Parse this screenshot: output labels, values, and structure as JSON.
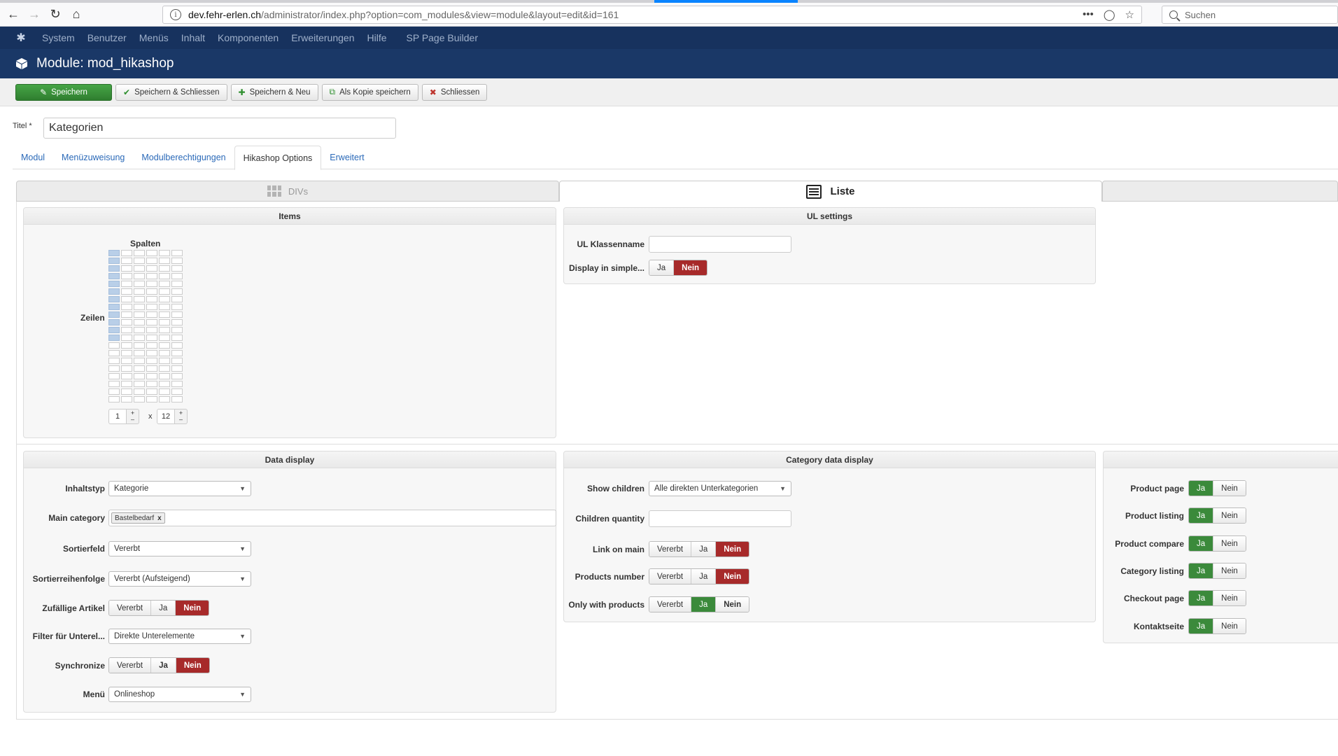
{
  "browser": {
    "url_host": "dev.fehr-erlen.ch",
    "url_path": "/administrator/index.php?option=com_modules&view=module&layout=edit&id=161",
    "search_placeholder": "Suchen",
    "url_actions_more": "•••"
  },
  "admin_menu": [
    "System",
    "Benutzer",
    "Menüs",
    "Inhalt",
    "Komponenten",
    "Erweiterungen",
    "Hilfe",
    "SP Page Builder"
  ],
  "page_title": "Module: mod_hikashop",
  "toolbar": {
    "save": "Speichern",
    "save_close": "Speichern & Schliessen",
    "save_new": "Speichern & Neu",
    "save_copy": "Als Kopie speichern",
    "close": "Schliessen"
  },
  "title_field": {
    "label": "Titel *",
    "value": "Kategorien"
  },
  "tabs": [
    "Modul",
    "Menüzuweisung",
    "Modulberechtigungen",
    "Hikashop Options",
    "Erweitert"
  ],
  "layout_tabs": {
    "divs": "DIVs",
    "list": "Liste"
  },
  "items_panel": {
    "title": "Items",
    "columns_label": "Spalten",
    "rows_label": "Zeilen",
    "columns_value": "1",
    "rows_value": "12",
    "times": "x",
    "plus": "+",
    "minus": "–"
  },
  "ul_panel": {
    "title": "UL settings",
    "class_label": "UL Klassenname",
    "simple_label": "Display in simple...",
    "simple_options": [
      "Ja",
      "Nein"
    ]
  },
  "data_display": {
    "title": "Data display",
    "content_type_label": "Inhaltstyp",
    "content_type_value": "Kategorie",
    "main_category_label": "Main category",
    "main_category_tag": "Bastelbedarf",
    "tag_remove": "x",
    "sort_field_label": "Sortierfeld",
    "sort_field_value": "Vererbt",
    "sort_order_label": "Sortierreihenfolge",
    "sort_order_value": "Vererbt (Aufsteigend)",
    "random_label": "Zufällige Artikel",
    "random_options": [
      "Vererbt",
      "Ja",
      "Nein"
    ],
    "filter_label": "Filter für Unterel...",
    "filter_value": "Direkte Unterelemente",
    "sync_label": "Synchronize",
    "sync_options": [
      "Vererbt",
      "Ja",
      "Nein"
    ],
    "menu_label": "Menü",
    "menu_value": "Onlineshop"
  },
  "category_display": {
    "title": "Category data display",
    "show_children_label": "Show children",
    "show_children_value": "Alle direkten Unterkategorien",
    "children_qty_label": "Children quantity",
    "link_main_label": "Link on main",
    "link_main_options": [
      "Vererbt",
      "Ja",
      "Nein"
    ],
    "products_number_label": "Products number",
    "products_number_options": [
      "Vererbt",
      "Ja",
      "Nein"
    ],
    "only_products_label": "Only with products",
    "only_products_options": [
      "Vererbt",
      "Ja",
      "Nein"
    ]
  },
  "pages_panel": {
    "rows": [
      {
        "label": "Product page",
        "yes": "Ja",
        "no": "Nein"
      },
      {
        "label": "Product listing",
        "yes": "Ja",
        "no": "Nein"
      },
      {
        "label": "Product compare",
        "yes": "Ja",
        "no": "Nein"
      },
      {
        "label": "Category listing",
        "yes": "Ja",
        "no": "Nein"
      },
      {
        "label": "Checkout page",
        "yes": "Ja",
        "no": "Nein"
      },
      {
        "label": "Kontaktseite",
        "yes": "Ja",
        "no": "Nein"
      }
    ]
  },
  "colors": {
    "accent_green": "#3b8a3b",
    "accent_red": "#a72a2a",
    "header_navy": "#17325e"
  }
}
